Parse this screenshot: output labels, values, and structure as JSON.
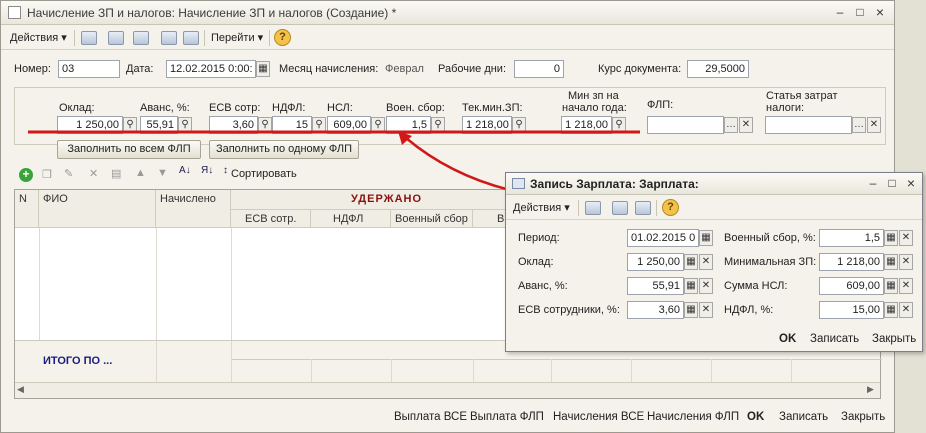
{
  "window": {
    "title": "Начисление ЗП и налогов: Начисление ЗП и налогов (Создание) *",
    "controls": [
      "–",
      "□",
      "×"
    ],
    "outer_controls": [
      "–",
      "□",
      "×"
    ]
  },
  "toolbar": {
    "actions": "Действия ▾",
    "goto": "Перейти ▾",
    "help": "?"
  },
  "header": {
    "number_label": "Номер:",
    "number_value": "03",
    "date_label": "Дата:",
    "date_value": "12.02.2015 0:00:",
    "month_label": "Месяц начисления:",
    "month_value": "Феврал",
    "workdays_label": "Рабочие дни:",
    "workdays_value": "0",
    "rate_label": "Курс документа:",
    "rate_value": "29,5000"
  },
  "params": {
    "salary_label": "Оклад:",
    "salary_value": "1 250,00",
    "advance_label": "Аванс, %:",
    "advance_value": "55,91",
    "esv_label": "ЕСВ сотр:",
    "esv_value": "3,60",
    "ndfl_label": "НДФЛ:",
    "ndfl_value": "15",
    "nsl_label": "НСЛ:",
    "nsl_value": "609,00",
    "mil_label": "Воен. сбор:",
    "mil_value": "1,5",
    "techmin_label": "Тек.мин.ЗП:",
    "techmin_value": "1 218,00",
    "minzp_label_1": "Мин зп на",
    "minzp_label_2": "начало года:",
    "minzp_value": "1 218,00",
    "flp_label": "ФЛП:",
    "flp_value": "",
    "cost_label_1": "Статья затрат",
    "cost_label_2": "налоги:",
    "cost_value": ""
  },
  "buttons": {
    "fill_all": "Заполнить по всем ФЛП",
    "fill_one": "Заполнить по одному ФЛП",
    "sort": "Сортировать"
  },
  "grid": {
    "col_n": "N",
    "col_fio": "ФИО",
    "col_accrued": "Начислено",
    "group_withheld": "УДЕРЖАНО",
    "sub_esv": "ЕСВ сотр.",
    "sub_ndfl": "НДФЛ",
    "sub_mil": "Военный сбор",
    "sub_partial": "В",
    "total_label": "ИТОГО ПО ..."
  },
  "footer": {
    "pay_all": "Выплата ВСЕ",
    "pay_flp": "Выплата ФЛП",
    "accr_all": "Начисления ВСЕ",
    "accr_flp": "Начисления ФЛП",
    "ok": "OK",
    "save": "Записать",
    "close": "Закрыть"
  },
  "dialog": {
    "title": "Запись Зарплата: Зарплата:",
    "actions": "Действия ▾",
    "help": "?",
    "period_label": "Период:",
    "period_value": "01.02.2015 0",
    "salary_label": "Оклад:",
    "salary_value": "1 250,00",
    "advance_label": "Аванс, %:",
    "advance_value": "55,91",
    "esv_label": "ЕСВ сотрудники, %:",
    "esv_value": "3,60",
    "mil_label": "Военный сбор, %:",
    "mil_value": "1,5",
    "minzp_label": "Минимальная ЗП:",
    "minzp_value": "1 218,00",
    "nsl_label": "Сумма НСЛ:",
    "nsl_value": "609,00",
    "ndfl_label": "НДФЛ, %:",
    "ndfl_value": "15,00",
    "ok": "OK",
    "save": "Записать",
    "close": "Закрыть",
    "controls": [
      "–",
      "□",
      "×"
    ]
  },
  "colors": {
    "annotation": "#d01818"
  }
}
